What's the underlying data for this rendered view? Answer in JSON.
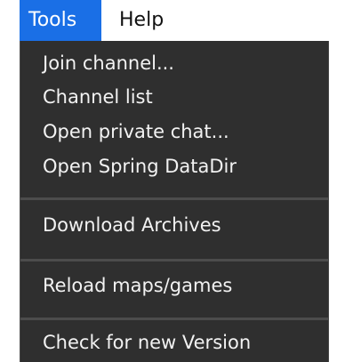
{
  "menubar": {
    "tools_label": "Tools",
    "help_label": "Help"
  },
  "dropdown": {
    "items": [
      {
        "label": "Join channel..."
      },
      {
        "label": "Channel list"
      },
      {
        "label": "Open private chat..."
      },
      {
        "label": "Open Spring DataDir"
      },
      {
        "label": "Download Archives"
      },
      {
        "label": "Reload maps/games"
      },
      {
        "label": "Check for new Version"
      }
    ]
  },
  "colors": {
    "menu_background": "#2f2f2f",
    "menu_text": "#f2f2f2",
    "active_menubar_item": "#1a6fe6",
    "separator": "#4c4c4c"
  }
}
